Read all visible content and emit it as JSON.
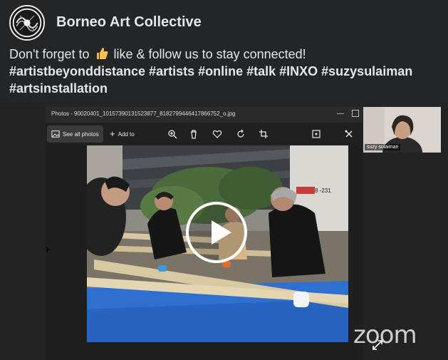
{
  "post": {
    "page_name": "Borneo Art Collective",
    "text_before_emoji": "Don't forget to ",
    "text_after_emoji": " like & follow us to stay connected!",
    "hashtags_line1": "#artistbeyonddistance #artists #online #talk #INXO #suzysulaiman",
    "hashtags_line2": "#artsinstallation",
    "emoji_icon": "thumbs-up-icon"
  },
  "video": {
    "photos_window_title": "Photos - 90020401_10157390131523877_8182799446417866752_o.jpg",
    "toolbar": {
      "see_all_photos": "See all photos",
      "add_to": "Add to"
    },
    "participant_name": "suzy sulaiman",
    "zoom_watermark": "zoom",
    "photo_sign": "8 -231"
  },
  "colors": {
    "background": "#242526",
    "text": "#e4e6eb",
    "tarp_blue": "#2e6fd0"
  }
}
